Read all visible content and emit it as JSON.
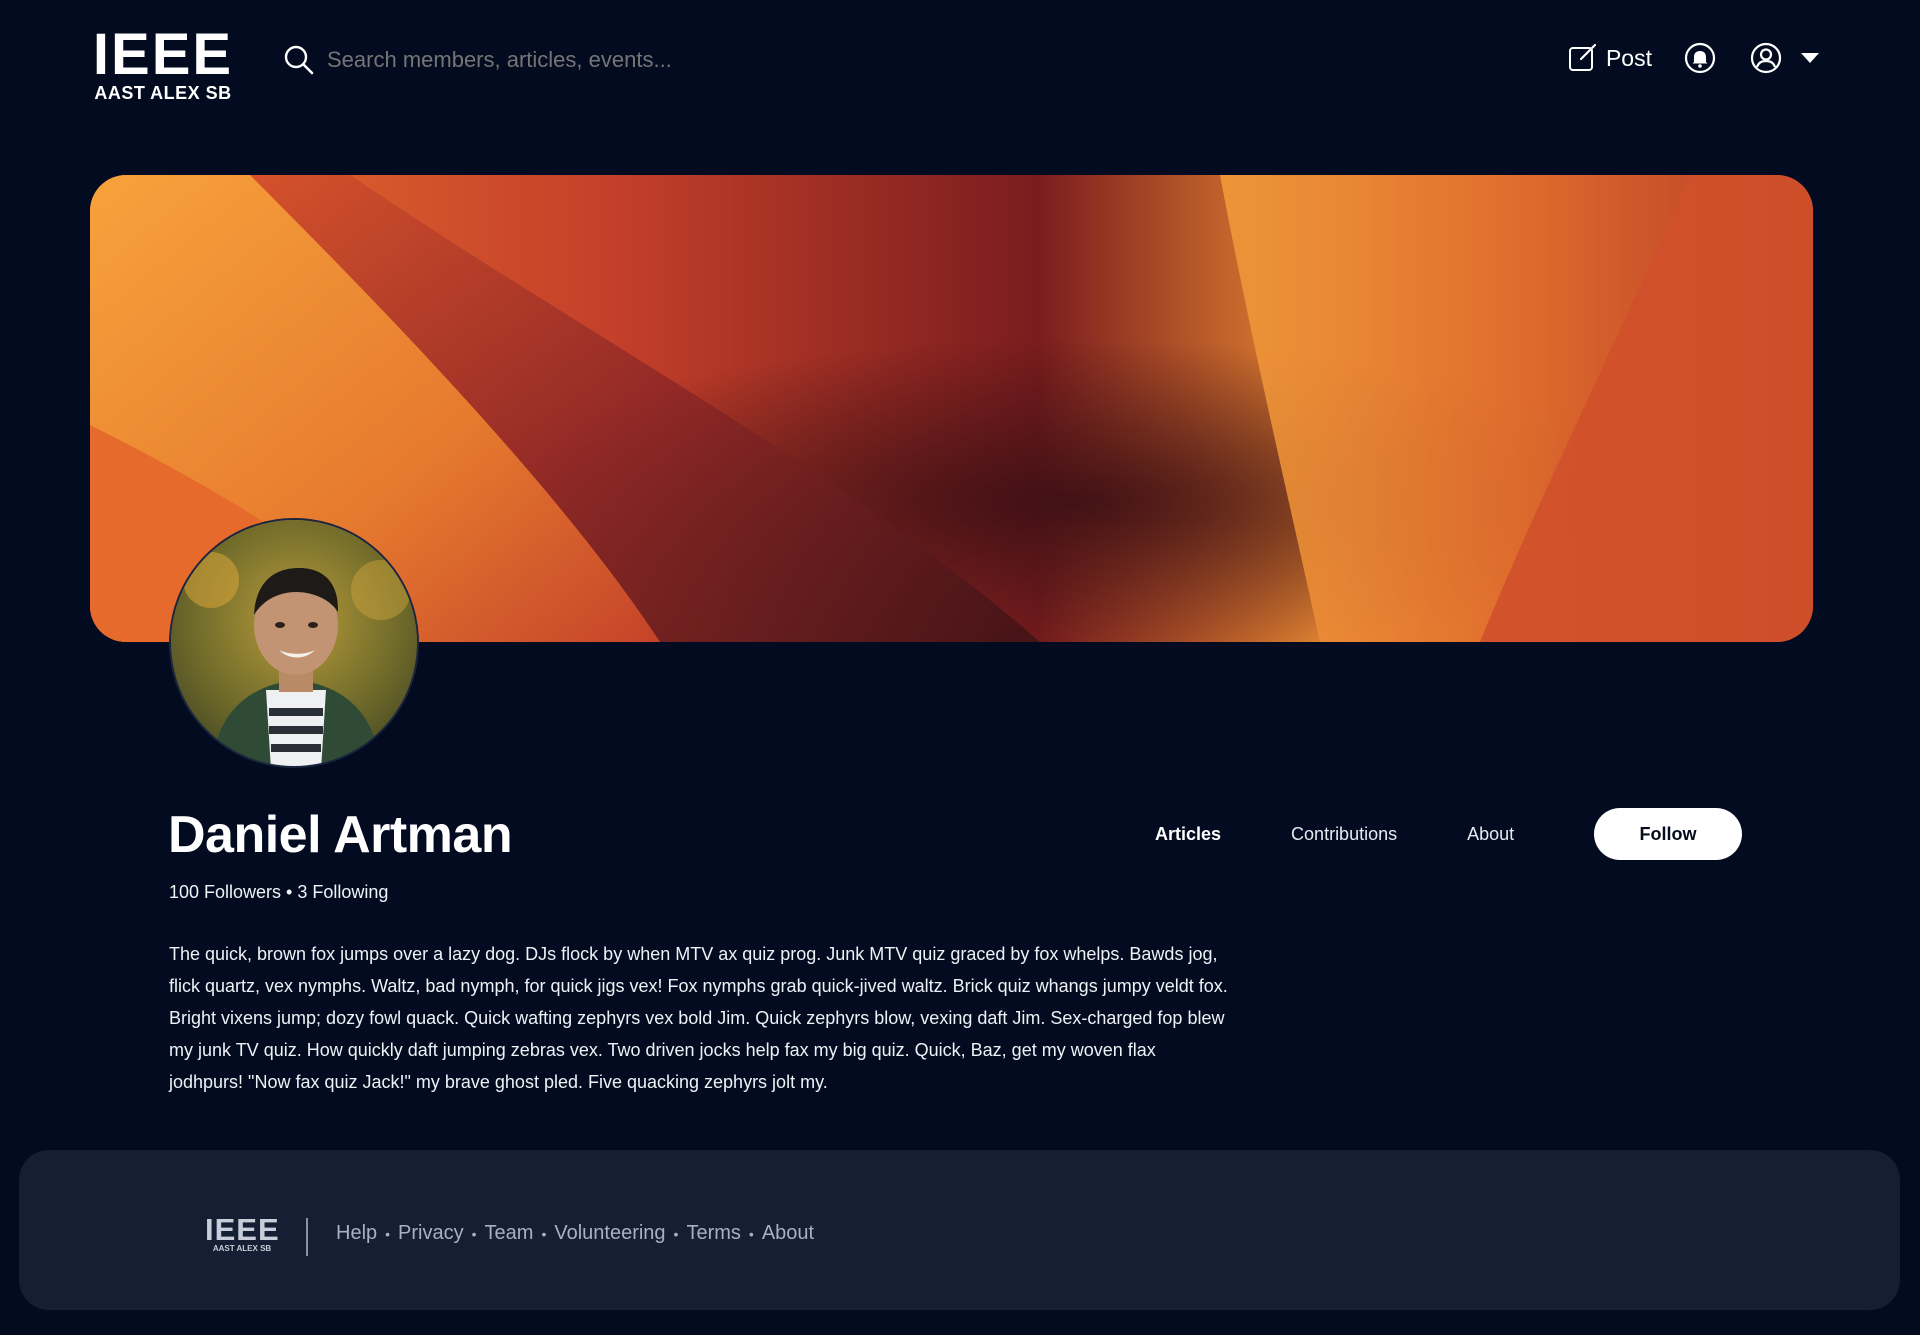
{
  "header": {
    "logo_title": "IEEE",
    "logo_subtitle": "AAST ALEX SB",
    "search_placeholder": "Search members, articles, events...",
    "post_label": "Post"
  },
  "profile": {
    "name": "Daniel Artman",
    "stats": "100 Followers • 3 Following",
    "bio": "The quick, brown fox jumps over a lazy dog. DJs flock by when MTV ax quiz prog. Junk MTV quiz graced by fox whelps. Bawds jog, flick quartz, vex nymphs. Waltz, bad nymph, for quick jigs vex! Fox nymphs grab quick-jived waltz. Brick quiz whangs jumpy veldt fox. Bright vixens jump; dozy fowl quack. Quick wafting zephyrs vex bold Jim. Quick zephyrs blow, vexing daft Jim. Sex-charged fop blew my junk TV quiz. How quickly daft jumping zebras vex. Two driven jocks help fax my big quiz. Quick, Baz, get my woven flax jodhpurs! \"Now fax quiz Jack!\" my brave ghost pled. Five quacking zephyrs jolt my."
  },
  "tabs": [
    {
      "label": "Articles",
      "active": true
    },
    {
      "label": "Contributions",
      "active": false
    },
    {
      "label": "About",
      "active": false
    }
  ],
  "follow_label": "Follow",
  "footer": {
    "logo_title": "IEEE",
    "logo_subtitle": "AAST ALEX SB",
    "links": [
      "Help",
      "Privacy",
      "Team",
      "Volunteering",
      "Terms",
      "About"
    ],
    "separator": "•"
  },
  "colors": {
    "background": "#020b1f",
    "footer_bg": "#141f33",
    "follow_bg": "#ffffff",
    "banner_orange": "#f5a33b",
    "banner_red": "#c9432a",
    "banner_dark": "#4a1418"
  },
  "icons": {
    "search": "search-icon",
    "post": "compose-icon",
    "notifications": "bell-icon",
    "account": "user-circle-icon",
    "menu": "caret-down-icon"
  }
}
